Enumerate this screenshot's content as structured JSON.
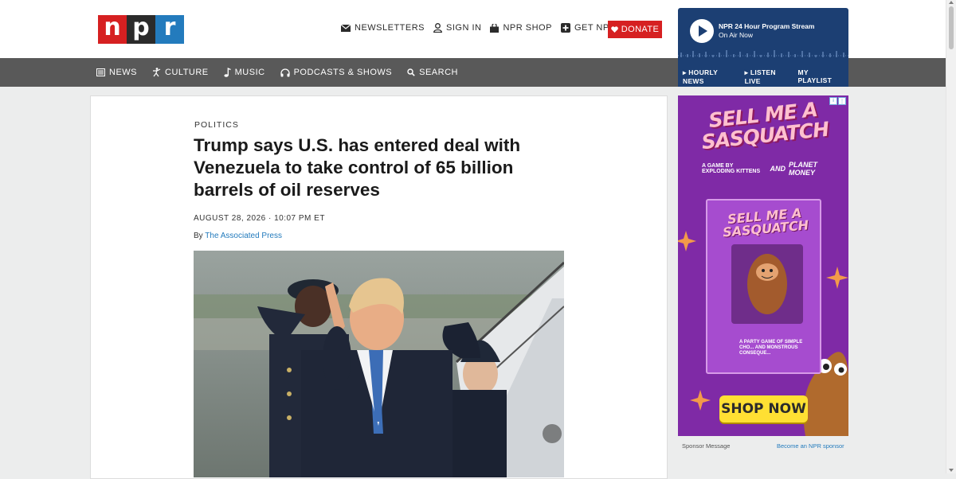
{
  "logo": {
    "letters": [
      "n",
      "p",
      "r"
    ]
  },
  "utility": {
    "newsletters": "NEWSLETTERS",
    "sign_in": "SIGN IN",
    "shop": "NPR SHOP",
    "get_npr": "GET NPR+",
    "donate": "DONATE"
  },
  "stream": {
    "title": "NPR 24 Hour Program Stream",
    "subtitle": "On Air Now",
    "links": [
      "▸ HOURLY NEWS",
      "▸ LISTEN LIVE",
      "MY PLAYLIST"
    ]
  },
  "nav": {
    "news": "NEWS",
    "culture": "CULTURE",
    "music": "MUSIC",
    "podcasts": "PODCASTS & SHOWS",
    "search": "SEARCH"
  },
  "article": {
    "kicker": "POLITICS",
    "headline": "Trump says U.S. has entered deal with Venezuela to take control of 65 billion barrels of oil reserves",
    "dateline": "AUGUST 28, 2026 · 10:07 PM ET",
    "byline_prefix": "By ",
    "byline_author": "The Associated Press"
  },
  "ad": {
    "headline": "SELL ME A SASQUATCH",
    "credit_small": "A GAME BY EXPLODING KITTENS",
    "credit_and": "AND",
    "credit_partner": "PLANET MONEY",
    "box_title": "SELL ME A SASQUATCH",
    "box_tagline": "A PARTY GAME OF SIMPLE CHO... AND MONSTROUS CONSEQUE...",
    "cta": "SHOP NOW",
    "sponsor_label": "Sponsor Message",
    "become_sponsor": "Become an NPR sponsor"
  },
  "colors": {
    "npr_red": "#d62021",
    "npr_black": "#2b2b2b",
    "npr_blue": "#237bbd",
    "nav_gray": "#595959",
    "stream_navy": "#1c3f73",
    "ad_purple": "#7f2aa6",
    "cta_yellow": "#ffe033"
  }
}
